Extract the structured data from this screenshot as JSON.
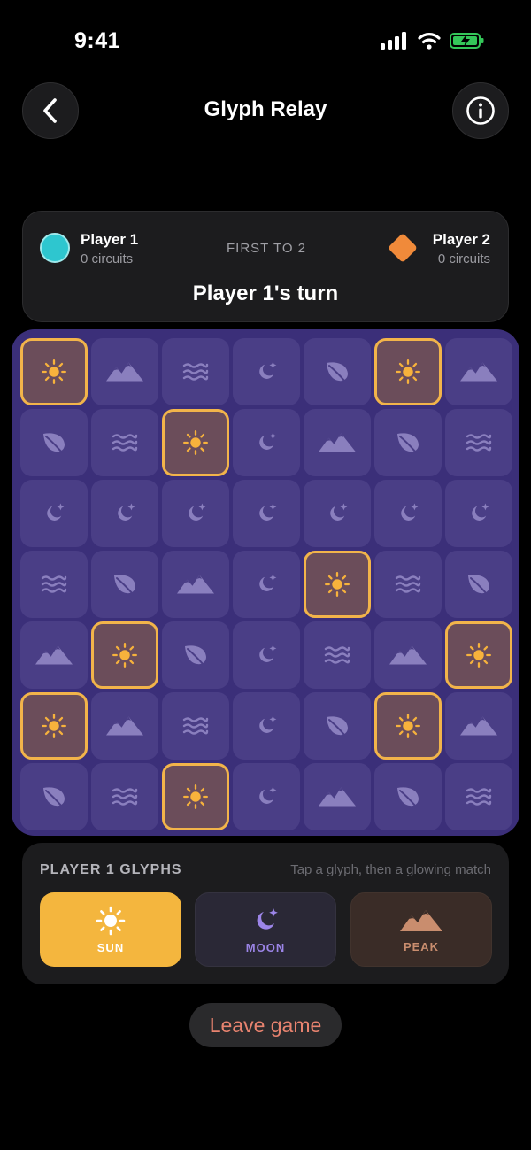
{
  "status_bar": {
    "time": "9:41"
  },
  "header": {
    "title": "Glyph Relay"
  },
  "score": {
    "player1": {
      "name": "Player 1",
      "circuits": "0 circuits",
      "color": "#2ec6cf"
    },
    "player2": {
      "name": "Player 2",
      "circuits": "0 circuits",
      "color": "#f08a3a"
    },
    "goal": "FIRST TO 2",
    "turn": "Player 1's turn"
  },
  "board": {
    "rows": [
      [
        "sun",
        "peak",
        "wave",
        "moon",
        "leaf",
        "sun",
        "peak"
      ],
      [
        "leaf",
        "wave",
        "sun",
        "moon",
        "peak",
        "leaf",
        "wave"
      ],
      [
        "moon",
        "moon",
        "moon",
        "moon",
        "moon",
        "moon",
        "moon"
      ],
      [
        "wave",
        "leaf",
        "peak",
        "moon",
        "sun",
        "wave",
        "leaf"
      ],
      [
        "peak",
        "sun",
        "leaf",
        "moon",
        "wave",
        "peak",
        "sun"
      ],
      [
        "sun",
        "peak",
        "wave",
        "moon",
        "leaf",
        "sun",
        "peak"
      ],
      [
        "leaf",
        "wave",
        "sun",
        "moon",
        "peak",
        "leaf",
        "wave"
      ]
    ],
    "glowing_glyph": "sun"
  },
  "glyphs_panel": {
    "title": "PLAYER 1 GLYPHS",
    "hint": "Tap a glyph, then a glowing match",
    "glyphs": [
      {
        "label": "SUN",
        "icon": "sun-icon",
        "selected": true
      },
      {
        "label": "MOON",
        "icon": "moon-icon",
        "selected": false
      },
      {
        "label": "PEAK",
        "icon": "peak-icon",
        "selected": false
      }
    ]
  },
  "leave_label": "Leave game"
}
